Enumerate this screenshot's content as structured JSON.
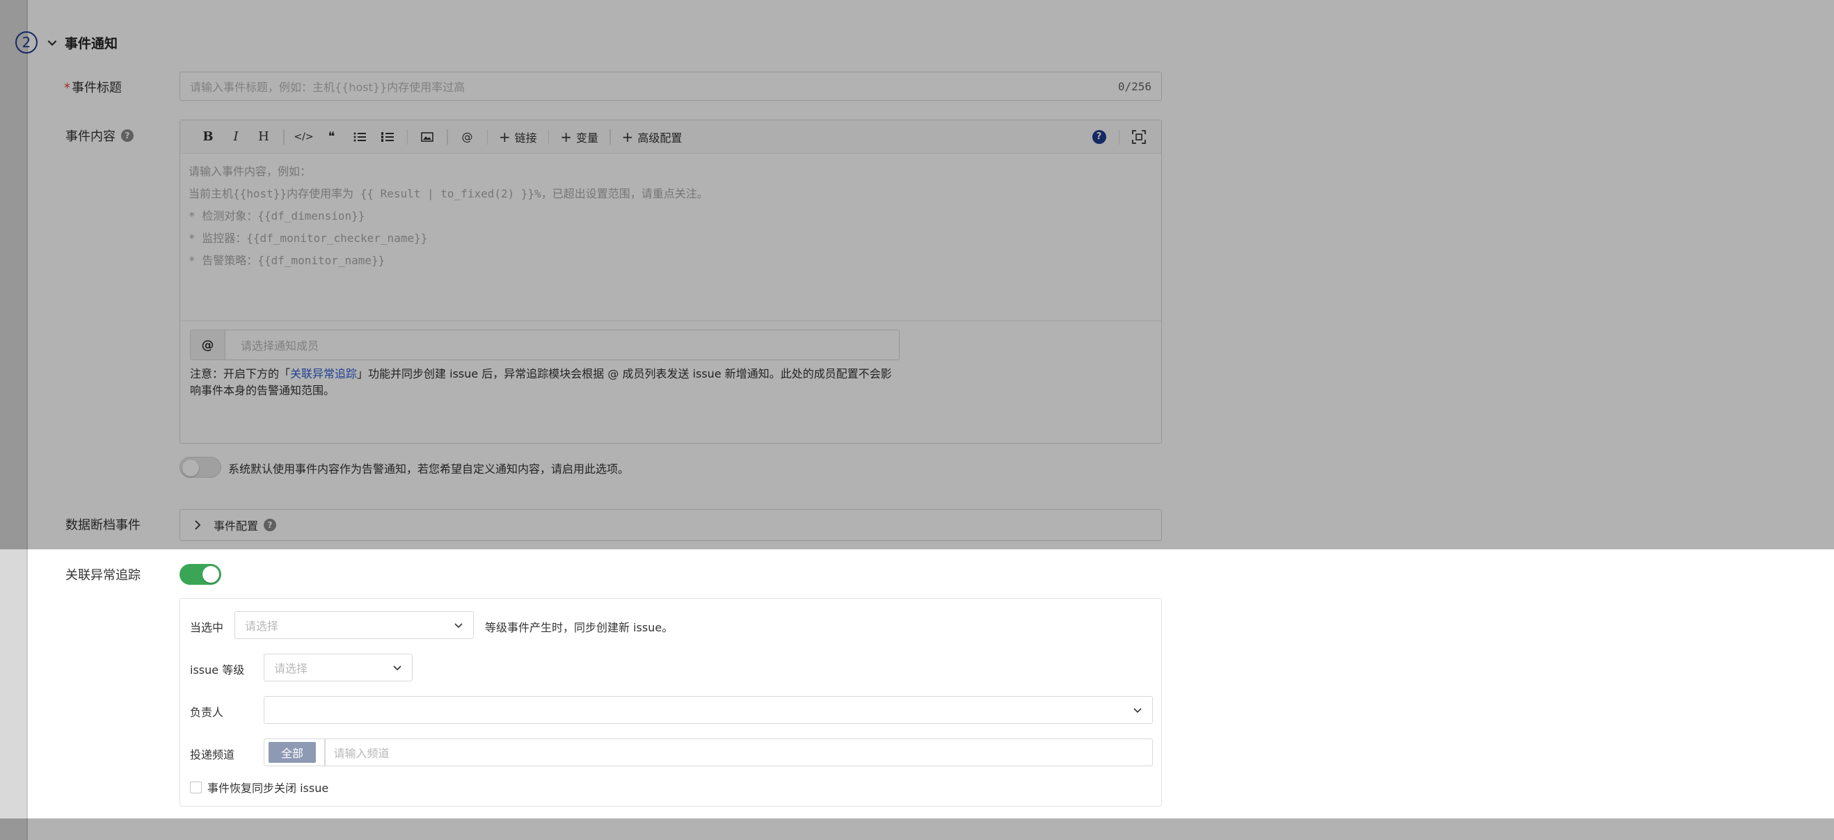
{
  "section": {
    "step_number": "2",
    "title": "事件通知"
  },
  "event_title": {
    "label": "事件标题",
    "required_mark": "*",
    "placeholder": "请输入事件标题，例如：主机{{host}}内存使用率过高",
    "counter": "0/256"
  },
  "event_content": {
    "label": "事件内容",
    "toolbar": {
      "bold": "B",
      "italic": "I",
      "heading": "H",
      "code": "</>",
      "quote": "❝",
      "link_label": "链接",
      "variable_label": "变量",
      "advanced_label": "高级配置",
      "at": "@"
    },
    "placeholder_lines": [
      "请输入事件内容，例如：",
      "当前主机{{host}}内存使用率为 {{ Result  | to_fixed(2) }}%，已超出设置范围，请重点关注。",
      "* 检测对象：{{df_dimension}}",
      "* 监控器：{{df_monitor_checker_name}}",
      "* 告警策略：{{df_monitor_name}}"
    ],
    "at_addon": "@",
    "member_placeholder": "请选择通知成员",
    "note_prefix": "注意：开启下方的「",
    "note_link": "关联异常追踪",
    "note_suffix": "」功能并同步创建 issue 后，异常追踪模块会根据 @ 成员列表发送 issue 新增通知。此处的成员配置不会影响事件本身的告警通知范围。"
  },
  "default_content_switch": {
    "on": false,
    "text": "系统默认使用事件内容作为告警通知，若您希望自定义通知内容，请启用此选项。"
  },
  "data_gap": {
    "label": "数据断档事件",
    "collapse_label": "事件配置"
  },
  "tracking": {
    "label": "关联异常追踪",
    "on": true,
    "when_label": "当选中",
    "level_placeholder": "请选择",
    "when_suffix": "等级事件产生时，同步创建新 issue。",
    "issue_level_label": "issue 等级",
    "issue_level_placeholder": "请选择",
    "owner_label": "负责人",
    "owner_value": "",
    "channel_label": "投递频道",
    "channel_tag": "全部",
    "channel_placeholder": "请输入频道",
    "close_checkbox_label": "事件恢复同步关闭 issue",
    "close_checked": false
  },
  "colors": {
    "accent": "#1f3b8f",
    "switch_on": "#3aa655",
    "link": "#2f5fd0",
    "required": "#e0452f"
  }
}
